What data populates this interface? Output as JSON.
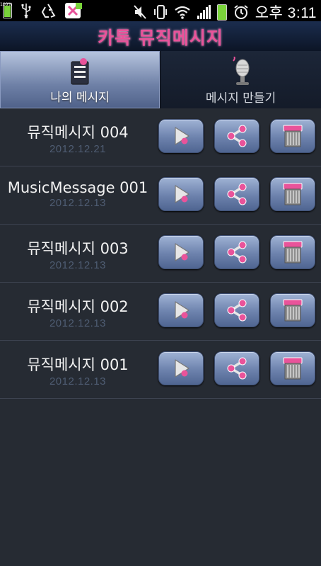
{
  "status_bar": {
    "battery_label": "100%",
    "time": "오후 3:11"
  },
  "app": {
    "title": "카톡 뮤직메시지"
  },
  "tabs": [
    {
      "label": "나의 메시지",
      "active": true
    },
    {
      "label": "메시지 만들기",
      "active": false
    }
  ],
  "messages": [
    {
      "title": "뮤직메시지 004",
      "date": "2012.12.21"
    },
    {
      "title": "MusicMessage 001",
      "date": "2012.12.13"
    },
    {
      "title": "뮤직메시지 003",
      "date": "2012.12.13"
    },
    {
      "title": "뮤직메시지 002",
      "date": "2012.12.13"
    },
    {
      "title": "뮤직메시지 001",
      "date": "2012.12.13"
    }
  ],
  "colors": {
    "accent_pink": "#e9539a",
    "button_blue": "#6d82ad",
    "date_text": "#4f5d73"
  }
}
